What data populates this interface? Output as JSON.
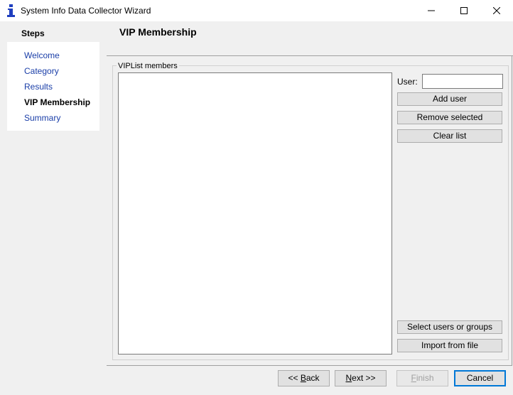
{
  "window": {
    "title": "System Info Data Collector Wizard",
    "icon": "info-icon"
  },
  "steps": {
    "title": "Steps",
    "items": [
      {
        "label": "Welcome",
        "active": false
      },
      {
        "label": "Category",
        "active": false
      },
      {
        "label": "Results",
        "active": false
      },
      {
        "label": "VIP Membership",
        "active": true
      },
      {
        "label": "Summary",
        "active": false
      }
    ]
  },
  "main": {
    "title": "VIP Membership",
    "group_label": "VIPList members",
    "user_label": "User:",
    "user_value": "",
    "buttons": {
      "add_user": "Add user",
      "remove_selected": "Remove selected",
      "clear_list": "Clear list",
      "select_users": "Select users or groups",
      "import_file": "Import from file"
    }
  },
  "nav": {
    "back_prefix": "<< ",
    "back_u": "B",
    "back_rest": "ack",
    "next_u": "N",
    "next_rest": "ext >>",
    "finish_u": "F",
    "finish_rest": "inish",
    "cancel": "Cancel"
  },
  "colors": {
    "link": "#1a3ea8",
    "accent": "#0078d7"
  }
}
